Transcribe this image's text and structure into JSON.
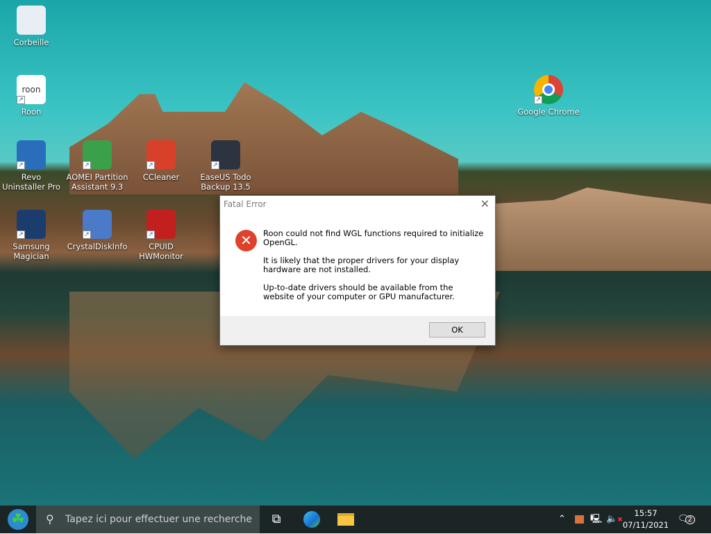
{
  "desktop": {
    "icons": [
      {
        "label": "Corbeille",
        "icon": "recycle-bin-icon",
        "color": "#e8eef4"
      },
      {
        "label": "Roon",
        "icon": "roon-icon",
        "color": "#ffffff"
      },
      {
        "label": "Google Chrome",
        "icon": "chrome-icon",
        "color": "#db4437"
      },
      {
        "label": "Revo Uninstaller Pro",
        "icon": "revo-icon",
        "color": "#2a6ebb"
      },
      {
        "label": "AOMEI Partition Assistant 9.3",
        "icon": "aomei-icon",
        "color": "#3aa04a"
      },
      {
        "label": "CCleaner",
        "icon": "ccleaner-icon",
        "color": "#d9402a"
      },
      {
        "label": "EaseUS Todo Backup 13.5",
        "icon": "easeus-icon",
        "color": "#2b3440"
      },
      {
        "label": "Samsung Magician",
        "icon": "samsung-magician-icon",
        "color": "#1b3d6e"
      },
      {
        "label": "CrystalDiskInfo",
        "icon": "crystaldiskinfo-icon",
        "color": "#4a7ac8"
      },
      {
        "label": "CPUID HWMonitor",
        "icon": "hwmonitor-icon",
        "color": "#c21f1f"
      }
    ]
  },
  "dialog": {
    "title": "Fatal Error",
    "close": "✕",
    "paragraphs": [
      "Roon could not find WGL functions required to initialize OpenGL.",
      "It is likely that the proper drivers for your display hardware are not installed.",
      "Up-to-date drivers should be available from the website of your computer or GPU manufacturer."
    ],
    "ok_label": "OK",
    "error_glyph": "✕"
  },
  "taskbar": {
    "search_placeholder": "Tapez ici pour effectuer une recherche",
    "time": "15:57",
    "date": "07/11/2021",
    "notifications": "2"
  }
}
